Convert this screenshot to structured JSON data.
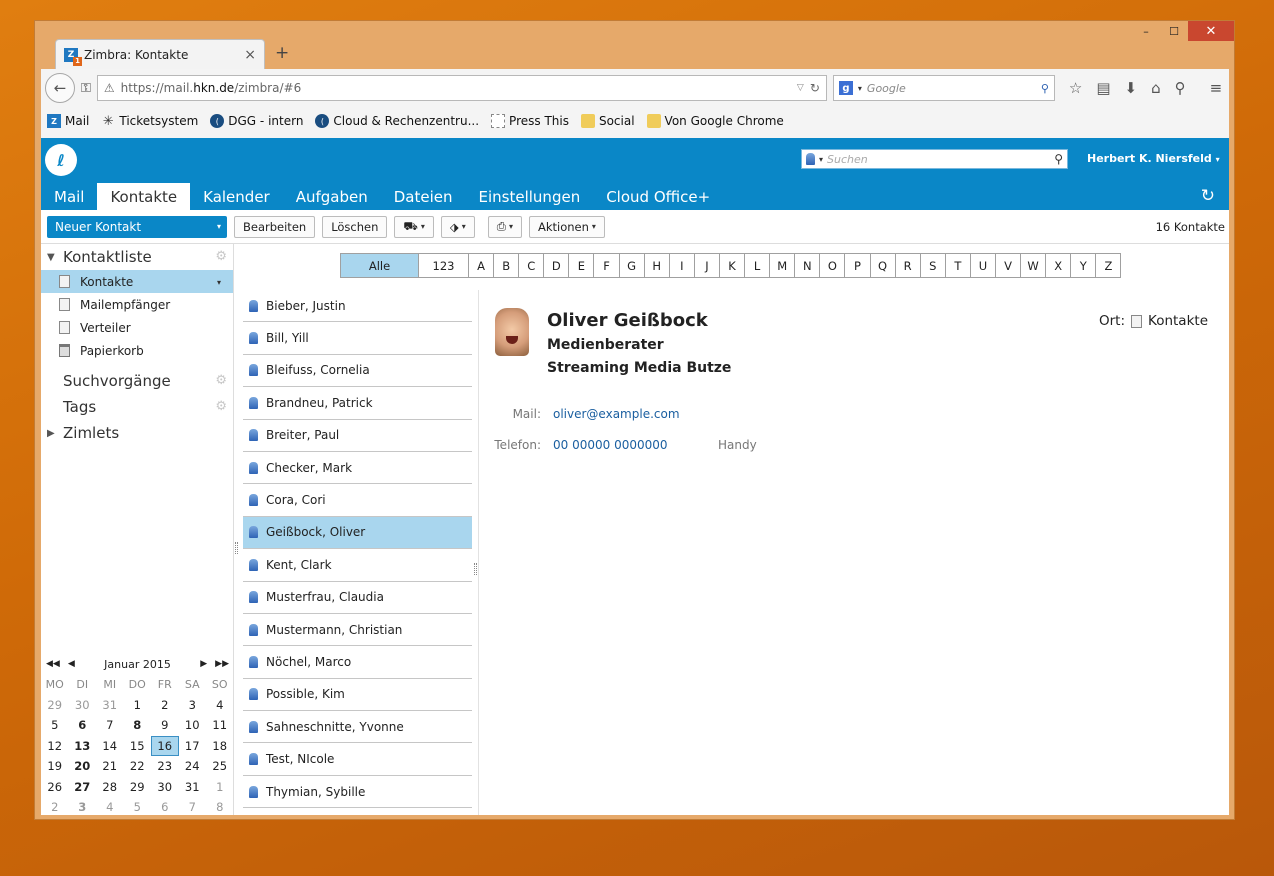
{
  "browser": {
    "window_controls": {
      "minimize": "–",
      "maximize": "☐",
      "close": "✕"
    },
    "tab": {
      "title": "Zimbra: Kontakte",
      "favicon_letter": "Z",
      "favicon_badge": "1"
    },
    "url": {
      "prefix": "https://mail.",
      "host": "hkn.de",
      "suffix": "/zimbra/#6"
    },
    "search": {
      "placeholder": "Google"
    },
    "bookmarks": [
      {
        "label": "Mail",
        "icon": "zimbra-icon"
      },
      {
        "label": "Ticketsystem",
        "icon": "otrs-icon"
      },
      {
        "label": "DGG - intern",
        "icon": "site-icon"
      },
      {
        "label": "Cloud & Rechenzentru...",
        "icon": "site-icon"
      },
      {
        "label": "Press This",
        "icon": "dashed-page-icon"
      },
      {
        "label": "Social",
        "icon": "folder-icon"
      },
      {
        "label": "Von Google Chrome",
        "icon": "folder-icon"
      }
    ]
  },
  "zimbra": {
    "search_placeholder": "Suchen",
    "user": "Herbert K. Niersfeld",
    "apps": [
      "Mail",
      "Kontakte",
      "Kalender",
      "Aufgaben",
      "Dateien",
      "Einstellungen",
      "Cloud Office+"
    ],
    "active_app": "Kontakte"
  },
  "toolbar": {
    "new_contact": "Neuer Kontakt",
    "edit": "Bearbeiten",
    "delete": "Löschen",
    "actions": "Aktionen",
    "count": "16 Kontakte"
  },
  "sidebar": {
    "contact_list_header": "Kontaktliste",
    "folders": [
      {
        "label": "Kontakte",
        "selected": true,
        "icon": "address-book-icon"
      },
      {
        "label": "Mailempfänger",
        "selected": false,
        "icon": "address-book-icon"
      },
      {
        "label": "Verteiler",
        "selected": false,
        "icon": "address-book-icon"
      },
      {
        "label": "Papierkorb",
        "selected": false,
        "icon": "trash-icon"
      }
    ],
    "searches_header": "Suchvorgänge",
    "tags_header": "Tags",
    "zimlets_header": "Zimlets"
  },
  "calendar": {
    "month": "Januar 2015",
    "weekdays": [
      "MO",
      "DI",
      "MI",
      "DO",
      "FR",
      "SA",
      "SO"
    ],
    "weeks": [
      [
        {
          "d": "29",
          "m": true
        },
        {
          "d": "30",
          "m": true
        },
        {
          "d": "31",
          "m": true
        },
        {
          "d": "1"
        },
        {
          "d": "2"
        },
        {
          "d": "3"
        },
        {
          "d": "4"
        }
      ],
      [
        {
          "d": "5"
        },
        {
          "d": "6",
          "b": true
        },
        {
          "d": "7"
        },
        {
          "d": "8",
          "b": true
        },
        {
          "d": "9"
        },
        {
          "d": "10"
        },
        {
          "d": "11"
        }
      ],
      [
        {
          "d": "12"
        },
        {
          "d": "13",
          "b": true
        },
        {
          "d": "14"
        },
        {
          "d": "15"
        },
        {
          "d": "16",
          "t": true
        },
        {
          "d": "17"
        },
        {
          "d": "18"
        }
      ],
      [
        {
          "d": "19"
        },
        {
          "d": "20",
          "b": true
        },
        {
          "d": "21"
        },
        {
          "d": "22"
        },
        {
          "d": "23"
        },
        {
          "d": "24"
        },
        {
          "d": "25"
        }
      ],
      [
        {
          "d": "26"
        },
        {
          "d": "27",
          "b": true
        },
        {
          "d": "28"
        },
        {
          "d": "29"
        },
        {
          "d": "30"
        },
        {
          "d": "31"
        },
        {
          "d": "1",
          "m": true
        }
      ],
      [
        {
          "d": "2",
          "m": true
        },
        {
          "d": "3",
          "m": true,
          "b": true
        },
        {
          "d": "4",
          "m": true
        },
        {
          "d": "5",
          "m": true
        },
        {
          "d": "6",
          "m": true
        },
        {
          "d": "7",
          "m": true
        },
        {
          "d": "8",
          "m": true
        }
      ]
    ]
  },
  "alphabet": [
    "Alle",
    "123",
    "A",
    "B",
    "C",
    "D",
    "E",
    "F",
    "G",
    "H",
    "I",
    "J",
    "K",
    "L",
    "M",
    "N",
    "O",
    "P",
    "Q",
    "R",
    "S",
    "T",
    "U",
    "V",
    "W",
    "X",
    "Y",
    "Z"
  ],
  "contacts": [
    "Bieber, Justin",
    "Bill, Yill",
    "Bleifuss, Cornelia",
    "Brandneu, Patrick",
    "Breiter, Paul",
    "Checker, Mark",
    "Cora, Cori",
    "Geißbock, Oliver",
    "Kent, Clark",
    "Musterfrau, Claudia",
    "Mustermann, Christian",
    "Nöchel, Marco",
    "Possible, Kim",
    "Sahneschnitte, Yvonne",
    "Test, NIcole",
    "Thymian, Sybille"
  ],
  "selected_contact": "Geißbock, Oliver",
  "detail": {
    "name": "Oliver Geißbock",
    "job_title": "Medienberater",
    "company": "Streaming Media Butze",
    "location_label": "Ort:",
    "location_value": "Kontakte",
    "mail_label": "Mail:",
    "mail": "oliver@example.com",
    "phone_label": "Telefon:",
    "phone": "00 00000 0000000",
    "mobile_label": "Handy"
  }
}
